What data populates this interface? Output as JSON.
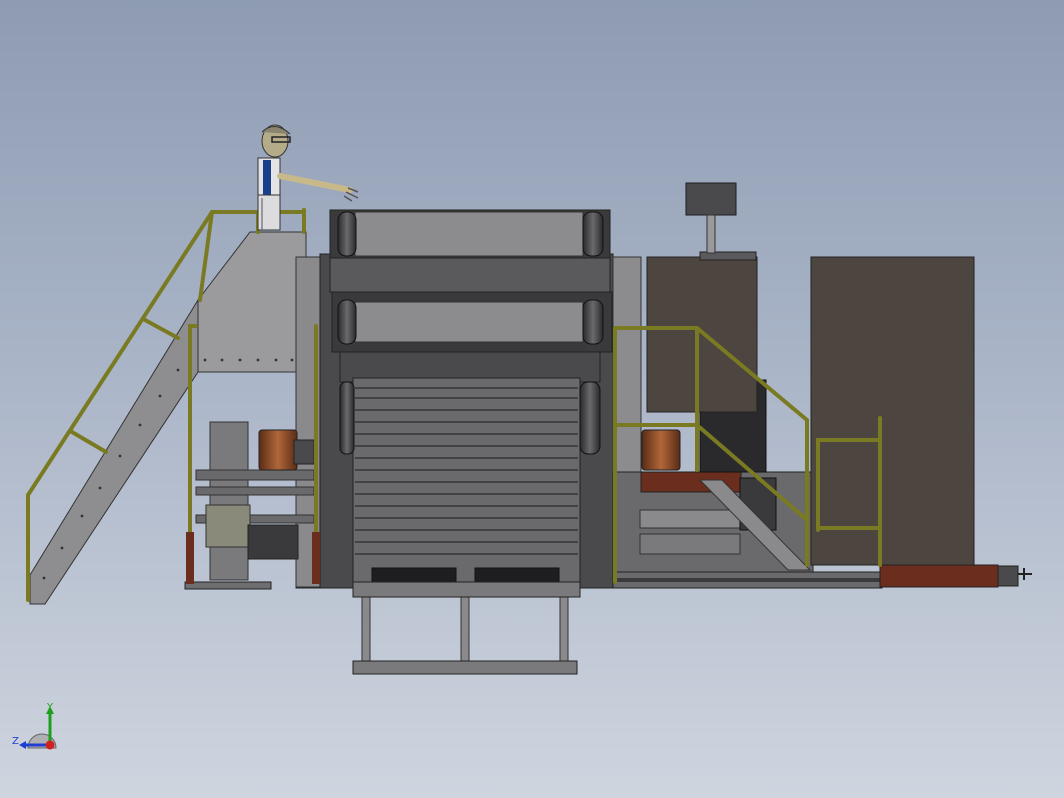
{
  "viewport": {
    "background_top": "#8e9bb2",
    "background_bottom": "#cfd5df"
  },
  "model": {
    "components": [
      "operator-figure",
      "access-stair",
      "upper-platform",
      "dryer-drum-stack",
      "gearbox",
      "control-panel-monitor",
      "electrical-cabinet",
      "tall-enclosure",
      "safety-railings",
      "motor-assembly",
      "base-frame",
      "support-legs"
    ],
    "colors": {
      "steel": "#6e6e70",
      "dark_steel": "#3a3a3c",
      "light_steel": "#8d8d8f",
      "railing": "#7a7a22",
      "cabinet": "#4d4540",
      "copper": "#8a4a2a",
      "rust": "#6b2e1e"
    }
  },
  "triad": {
    "y_label": "Y",
    "z_label": "Z",
    "y_color": "#1ca01c",
    "z_color": "#1f3fd0",
    "x_color": "#d02020"
  }
}
